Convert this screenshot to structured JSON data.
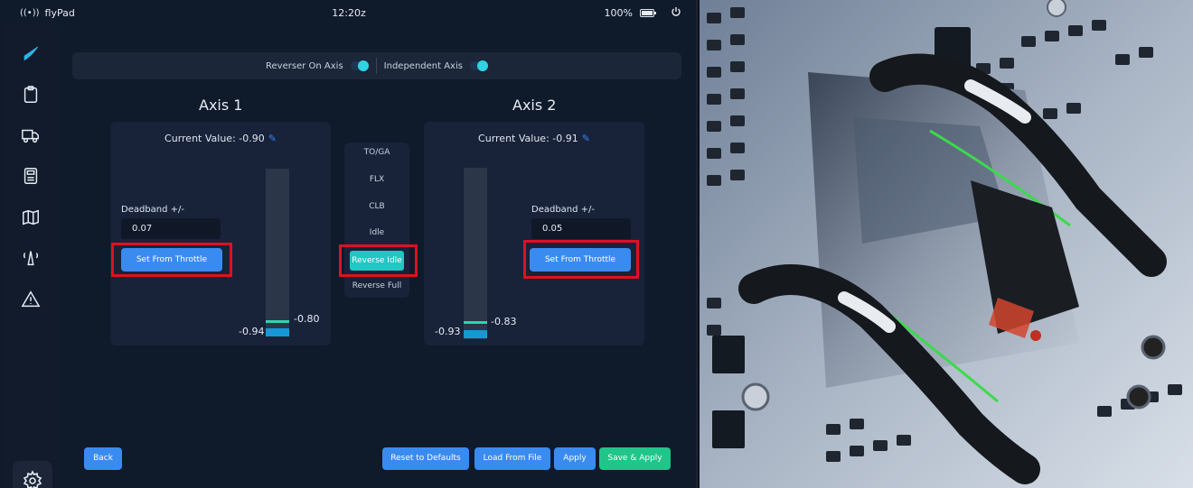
{
  "status_bar": {
    "app_name": "flyPad",
    "clock": "12:20z",
    "battery": "100%"
  },
  "colors": {
    "accent": "#2fd3e3",
    "primary_button": "#3a8bf0",
    "save_button": "#20c58a",
    "highlight_frame": "#e01020",
    "panel_bg": "#0f1a2b"
  },
  "sidebar": {
    "items": [
      {
        "icon": "logo-icon"
      },
      {
        "icon": "clipboard-icon"
      },
      {
        "icon": "truck-icon"
      },
      {
        "icon": "calculator-icon"
      },
      {
        "icon": "map-icon"
      },
      {
        "icon": "tower-icon"
      },
      {
        "icon": "warning-icon"
      }
    ],
    "settings_icon": "gear-icon"
  },
  "options": {
    "reverser_on_axis": {
      "label": "Reverser On Axis",
      "enabled": true
    },
    "independent_axis": {
      "label": "Independent Axis",
      "enabled": true
    }
  },
  "axis1": {
    "title": "Axis 1",
    "current_value_label": "Current Value: -0.90",
    "deadband_label": "Deadband +/-",
    "deadband_value": "0.07",
    "set_button": "Set From Throttle",
    "lower_label": "-0.94",
    "upper_label": "-0.80"
  },
  "axis2": {
    "title": "Axis 2",
    "current_value_label": "Current Value: -0.91",
    "deadband_label": "Deadband +/-",
    "deadband_value": "0.05",
    "set_button": "Set From Throttle",
    "lower_label": "-0.93",
    "upper_label": "-0.83"
  },
  "detents": {
    "items": [
      "TO/GA",
      "FLX",
      "CLB",
      "Idle",
      "Reverse Idle",
      "Reverse Full"
    ],
    "selected": "Reverse Idle"
  },
  "footer": {
    "back": "Back",
    "reset": "Reset to Defaults",
    "load": "Load From File",
    "apply": "Apply",
    "save_apply": "Save & Apply"
  }
}
